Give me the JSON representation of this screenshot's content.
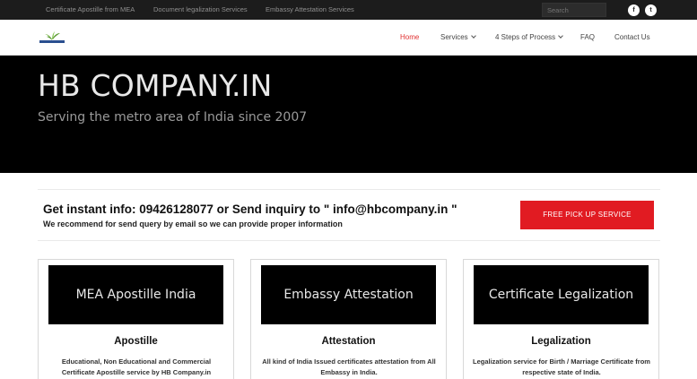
{
  "topbar": {
    "links": [
      "Certificate Apostille from MEA",
      "Document legalization Services",
      "Embassy Attestation Services"
    ],
    "search_placeholder": "Search",
    "social": [
      {
        "icon": "facebook-icon",
        "glyph": "f"
      },
      {
        "icon": "twitter-icon",
        "glyph": "t"
      }
    ]
  },
  "nav": {
    "items": [
      {
        "label": "Home",
        "active": true,
        "dropdown": false
      },
      {
        "label": "Services",
        "active": false,
        "dropdown": true
      },
      {
        "label": "4 Steps of Process",
        "active": false,
        "dropdown": true
      },
      {
        "label": "FAQ",
        "active": false,
        "dropdown": false
      },
      {
        "label": "Contact Us",
        "active": false,
        "dropdown": false
      }
    ]
  },
  "hero": {
    "title": "HB COMPANY.IN",
    "subtitle": "Serving the metro area of India since 2007"
  },
  "info": {
    "main": "Get instant info: 09426128077 or Send inquiry to \" info@hbcompany.in \"",
    "sub": "We recommend for send query by email so we can provide proper information",
    "button": "FREE PICK UP SERVICE"
  },
  "cards": [
    {
      "image_text": "MEA Apostille India",
      "title": "Apostille",
      "desc": "Educational, Non Educational and Commercial Certificate Apostille service by HB Company.in"
    },
    {
      "image_text": "Embassy Attestation",
      "title": "Attestation",
      "desc": "All kind of India Issued certificates attestation from All Embassy in India."
    },
    {
      "image_text": "Certificate Legalization",
      "title": "Legalization",
      "desc": "Legalization service for Birth / Marriage Certificate from respective state of India."
    }
  ],
  "colors": {
    "accent": "#e11b22",
    "nav_active": "#e03030",
    "topbar_bg": "#1c1c1c",
    "hero_bg": "#000000"
  }
}
